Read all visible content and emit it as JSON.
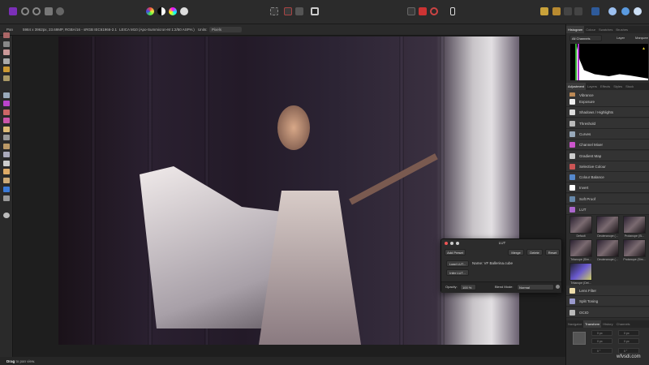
{
  "context_bar": {
    "label": "Pan",
    "image_info": "5984 x 3962px, 23.69MP, RGBA/16 - sRGB IEC61966-2.1",
    "camera": "LEICA M10 (Apo-Summicron-M 1:2/50 ASPH.)",
    "units_label": "Units:",
    "units_value": "Pixels"
  },
  "toolbar": {
    "personas": [
      "affinity-photo-persona-icon",
      "liquify-persona-icon",
      "develop-persona-icon",
      "tone-mapping-persona-icon",
      "export-persona-icon"
    ]
  },
  "histogram_panel": {
    "tabs": [
      "Histogram",
      "Colour",
      "Swatches",
      "Brushes"
    ],
    "active": "Histogram",
    "channel": "All Channels",
    "layer_label": "Layer",
    "marquee_label": "Marquee"
  },
  "adjustment_panel": {
    "tabs": [
      "Adjustment",
      "Layers",
      "Effects",
      "Styles",
      "Stock"
    ],
    "active": "Adjustment",
    "items": [
      "Vibrance",
      "Exposure",
      "Shadows / Highlights",
      "Threshold",
      "Curves",
      "Channel Mixer",
      "Gradient Map",
      "Selective Colour",
      "Colour Balance",
      "Invert",
      "Soft Proof",
      "LUT"
    ],
    "lut_presets": [
      "Default",
      "Deuteranope (...",
      "Protanope (Si...",
      "Tritanope (Sim...",
      "Deuteranope (...",
      "Protanope (Sim...",
      "Tritanope (Det..."
    ],
    "items_after": [
      "Lens Filter",
      "Split Toning",
      "OCIO"
    ]
  },
  "transform_panel": {
    "tabs": [
      "Navigator",
      "Transform",
      "History",
      "Channels"
    ],
    "active": "Transform",
    "fields": [
      {
        "label": "X:",
        "value": "0 px"
      },
      {
        "label": "W:",
        "value": "0 px"
      },
      {
        "label": "Y:",
        "value": "0 px"
      },
      {
        "label": "H:",
        "value": "0 px"
      },
      {
        "label": "R:",
        "value": "0 °"
      },
      {
        "label": "S:",
        "value": "0 °"
      }
    ]
  },
  "lut_dialog": {
    "title": "LUT",
    "add_preset": "Add Preset",
    "merge": "Merge",
    "delete": "Delete",
    "reset": "Reset",
    "load_lut": "Load LUT...",
    "infer_lut": "Infer LUT...",
    "name_text": "Name: VF Ballerina.cube",
    "opacity_label": "Opacity:",
    "opacity_value": "100 %",
    "blend_label": "Blend Mode:",
    "blend_value": "Normal"
  },
  "status": {
    "hint_bold": "Drag",
    "hint": " to pan view."
  },
  "watermark": "wfvsdi.com"
}
